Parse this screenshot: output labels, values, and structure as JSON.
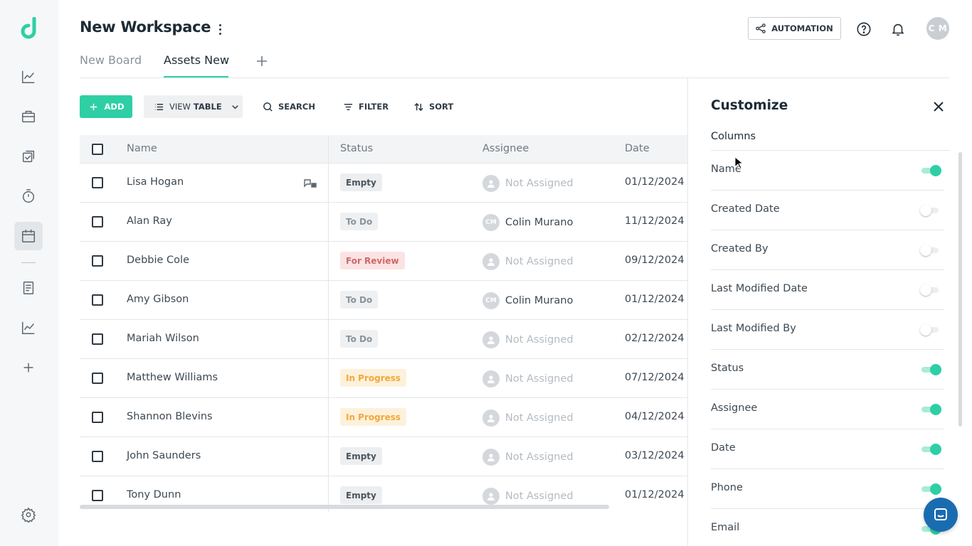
{
  "workspace": {
    "title": "New Workspace"
  },
  "header": {
    "automation_label": "AUTOMATION",
    "avatar_initials": "C M"
  },
  "tabs": [
    {
      "label": "New Board",
      "active": false
    },
    {
      "label": "Assets New",
      "active": true
    }
  ],
  "toolbar": {
    "add_label": "ADD",
    "view_prefix": "VIEW",
    "view_value": "TABLE",
    "search_label": "SEARCH",
    "filter_label": "FILTER",
    "sort_label": "SORT"
  },
  "table": {
    "columns": [
      "Name",
      "Status",
      "Assignee",
      "Date"
    ],
    "rows": [
      {
        "name": "Lisa Hogan",
        "status": "Empty",
        "assignee": "Not Assigned",
        "assignee_initials": "",
        "date": "01/12/2024"
      },
      {
        "name": "Alan Ray",
        "status": "To Do",
        "assignee": "Colin Murano",
        "assignee_initials": "CM",
        "date": "11/12/2024"
      },
      {
        "name": "Debbie Cole",
        "status": "For Review",
        "assignee": "Not Assigned",
        "assignee_initials": "",
        "date": "09/12/2024"
      },
      {
        "name": "Amy Gibson",
        "status": "To Do",
        "assignee": "Colin Murano",
        "assignee_initials": "CM",
        "date": "01/12/2024"
      },
      {
        "name": "Mariah Wilson",
        "status": "To Do",
        "assignee": "Not Assigned",
        "assignee_initials": "",
        "date": "02/12/2024"
      },
      {
        "name": "Matthew Williams",
        "status": "In Progress",
        "assignee": "Not Assigned",
        "assignee_initials": "",
        "date": "07/12/2024"
      },
      {
        "name": "Shannon Blevins",
        "status": "In Progress",
        "assignee": "Not Assigned",
        "assignee_initials": "",
        "date": "04/12/2024"
      },
      {
        "name": "John Saunders",
        "status": "Empty",
        "assignee": "Not Assigned",
        "assignee_initials": "",
        "date": "03/12/2024"
      },
      {
        "name": "Tony Dunn",
        "status": "Empty",
        "assignee": "Not Assigned",
        "assignee_initials": "",
        "date": "01/12/2024"
      }
    ]
  },
  "status_colors": {
    "Empty": {
      "bg": "#eceef0",
      "fg": "#4a545d"
    },
    "To Do": {
      "bg": "#eef0f2",
      "fg": "#8a939b"
    },
    "For Review": {
      "bg": "#fbe3e3",
      "fg": "#d06868"
    },
    "In Progress": {
      "bg": "#fdf1dc",
      "fg": "#f0a93a"
    }
  },
  "customize": {
    "title": "Customize",
    "section": "Columns",
    "items": [
      {
        "label": "Name",
        "on": true
      },
      {
        "label": "Created Date",
        "on": false
      },
      {
        "label": "Created By",
        "on": false
      },
      {
        "label": "Last Modified Date",
        "on": false
      },
      {
        "label": "Last Modified By",
        "on": false
      },
      {
        "label": "Status",
        "on": true
      },
      {
        "label": "Assignee",
        "on": true
      },
      {
        "label": "Date",
        "on": true
      },
      {
        "label": "Phone",
        "on": true
      },
      {
        "label": "Email",
        "on": true
      }
    ]
  },
  "colors": {
    "accent": "#2ecfa4",
    "chat": "#1a6cb1"
  },
  "icons": [
    "logo-icon",
    "analytics-icon",
    "briefcase-icon",
    "tasks-icon",
    "timer-icon",
    "calendar-icon",
    "document-icon",
    "chart-icon",
    "plus-icon",
    "settings-icon",
    "automation-icon",
    "help-icon",
    "bell-icon",
    "chat-icon"
  ]
}
